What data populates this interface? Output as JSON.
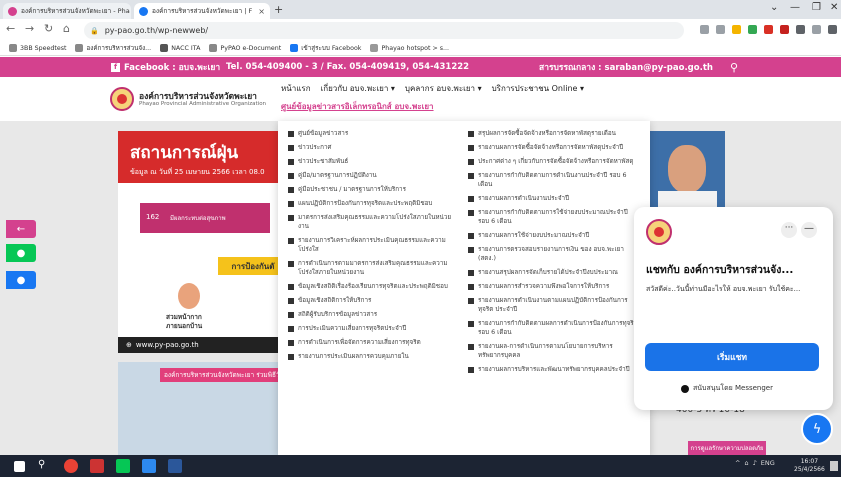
{
  "browser": {
    "tabs": [
      {
        "title": "องค์การบริหารส่วนจังหวัดพะเยา - Pha",
        "active": false
      },
      {
        "title": "องค์การบริหารส่วนจังหวัดพะเยา | F",
        "active": true
      }
    ],
    "new_tab": "+",
    "url": "py-pao.go.th/wp-newweb/",
    "bookmarks": [
      {
        "label": "3BB Speedtest",
        "color": "#888888"
      },
      {
        "label": "องค์การบริหารส่วนจัง...",
        "color": "#888888"
      },
      {
        "label": "NACC ITA",
        "color": "#555555"
      },
      {
        "label": "PyPAO e-Document",
        "color": "#888888"
      },
      {
        "label": "เข้าสู่ระบบ Facebook",
        "color": "#1877f2"
      },
      {
        "label": "Phayao hotspot > s...",
        "color": "#999999"
      }
    ]
  },
  "site": {
    "topbar": {
      "facebook": "Facebook : อบจ.พะเยา",
      "phone": "Tel. 054-409400 - 3 / Fax. 054-409419, 054-431222",
      "email": "สารบรรณกลาง : saraban@py-pao.go.th"
    },
    "org_name": "องค์การบริหารส่วนจังหวัดพะเยา",
    "org_sub": "Phayao Provincial Administrative Organization",
    "nav": [
      "หน้าแรก",
      "เกี่ยวกับ อบจ.พะเยา ▾",
      "บุคลากร อบจ.พะเยา ▾",
      "บริการประชาชน Online ▾"
    ],
    "subnav": "ศูนย์ข้อมูลข่าวสารอิเล็กทรอนิกส์ อบจ.พะเยา"
  },
  "banner": {
    "headline": "สถานการณ์ฝุ่น",
    "date": "ข้อมูล ณ วันที่ 25 เมษายน 2566 เวลา 08.0",
    "aqi": "162",
    "aqi_label": "มีผลกระทบต่อสุขภาพ",
    "protect": "การป้องกันตั",
    "caption": "สวมหน้ากาก\nภายนอกบ้าน",
    "footer": "www.py-pao.go.th"
  },
  "photo_banner": "องค์การบริหารส่วนจังหวัดพะเยา ร่วมพิธีวันเฉลิมพระเกียรติ",
  "dropdown": {
    "left": [
      "ศูนย์ข้อมูลข่าวสาร",
      "ข่าวประกาศ",
      "ข่าวประชาสัมพันธ์",
      "คู่มือ/มาตรฐานการปฏิบัติงาน",
      "คู่มือประชาชน / มาตรฐานการให้บริการ",
      "แผนปฏิบัติการป้องกันการทุจริตและประพฤติมิชอบ",
      "มาตรการส่งเสริมคุณธรรมและความโปร่งใสภายในหน่วยงาน",
      "รายงานการวิเคราะห์ผลการประเมินคุณธรรมและความโปร่งใส",
      "การดำเนินการตามมาตรการส่งเสริมคุณธรรมและความโปร่งใสภายในหน่วยงาน",
      "ข้อมูลเชิงสถิติเรื่องร้องเรียนการทุจริตและประพฤติมิชอบ",
      "ข้อมูลเชิงสถิติการให้บริการ",
      "สถิติผู้รับบริการข้อมูลข่าวสาร",
      "การประเมินความเสี่ยงการทุจริตประจำปี",
      "การดำเนินการเพื่อจัดการความเสี่ยงการทุจริต",
      "รายงานการประเมินผลการควบคุมภายใน"
    ],
    "right": [
      "สรุปผลการจัดซื้อจัดจ้างหรือการจัดหาพัสดุรายเดือน",
      "รายงานผลการจัดซื้อจัดจ้างหรือการจัดหาพัสดุประจำปี",
      "ประกาศต่าง ๆ เกี่ยวกับการจัดซื้อจัดจ้างหรือการจัดหาพัสดุ",
      "รายงานการกำกับติดตามการดำเนินงานประจำปี รอบ 6 เดือน",
      "รายงานผลการดำเนินงานประจำปี",
      "รายงานการกำกับติดตามการใช้จ่ายงบประมาณประจำปี รอบ 6 เดือน",
      "รายงานผลการใช้จ่ายงบประมาณประจำปี",
      "รายงานการตรวจสอบรายงานการเงิน ของ อบจ.พะเยา (สตง.)",
      "รายงานสรุปผลการจัดเก็บรายได้ประจำปีงบประมาณ",
      "รายงานผลการสำรวจความพึงพอใจการให้บริการ",
      "รายงานผลการดำเนินงานตามแผนปฏิบัติการป้องกันการทุจริต ประจำปี",
      "รายงานการกำกับติดตามผลการดำเนินการป้องกันการทุจริต รอบ 6 เดือน",
      "รายงานผล-การดำเนินการตามนโยบายการบริหารทรัพยากรบุคคล",
      "รายงานผลการบริหารและพัฒนาทรัพยากรบุคคลประจำปี"
    ]
  },
  "behind_text": "400-3 ทร 10-18",
  "chat": {
    "title": "แชทกับ องค์การบริหารส่วนจัง...",
    "greeting": "สวัสดีค่ะ..วันนี้ท่านมีอะไรให้ อบจ.พะเยา รับใช้คะ...",
    "start_button": "เริ่มแชท",
    "powered": "สนับสนุนโดย Messenger",
    "more": "···",
    "minimize": "—"
  },
  "bottom_button": "การดูแลรักษาความปลอดภัย",
  "taskbar": {
    "lang": "ENG",
    "time": "16:07",
    "date": "25/4/2566"
  }
}
